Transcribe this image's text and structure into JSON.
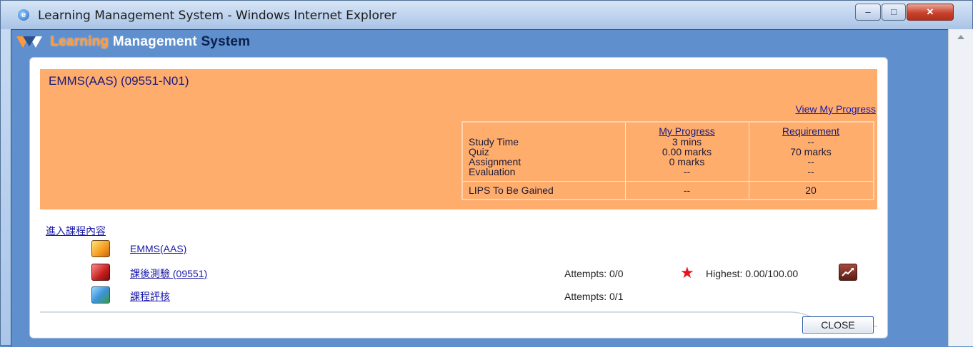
{
  "window": {
    "title": "Learning Management System - Windows Internet Explorer",
    "minimize_label": "–",
    "maximize_label": "□",
    "close_label": "✕"
  },
  "app": {
    "name_part1": "Learning",
    "name_part2": "Management",
    "name_part3": "System"
  },
  "course": {
    "title": "EMMS(AAS) (09551-N01)",
    "view_progress_label": "View My Progress"
  },
  "progress_table": {
    "headers": {
      "my_progress": "My Progress",
      "requirement": "Requirement"
    },
    "rows": [
      {
        "label": "Study Time",
        "progress": "3 mins",
        "requirement": "--"
      },
      {
        "label": "Quiz",
        "progress": "0.00 marks",
        "requirement": "70 marks"
      },
      {
        "label": "Assignment",
        "progress": "0 marks",
        "requirement": "--"
      },
      {
        "label": "Evaluation",
        "progress": "--",
        "requirement": "--"
      }
    ],
    "lips": {
      "label": "LIPS To Be Gained",
      "progress": "--",
      "requirement": "20"
    }
  },
  "content": {
    "enter_label": "進入課程內容",
    "items": [
      {
        "icon": "courseware-icon",
        "label": "EMMS(AAS)",
        "attempts": ""
      },
      {
        "icon": "quiz-icon",
        "label": "課後測驗 (09551)",
        "attempts": "Attempts: 0/0"
      },
      {
        "icon": "evaluation-icon",
        "label": "課程評核",
        "attempts": "Attempts: 0/1"
      }
    ],
    "highest": "Highest: 0.00/100.00"
  },
  "actions": {
    "close_label": "CLOSE"
  },
  "colors": {
    "panel_orange": "#ffad6c",
    "link_blue": "#1a1aa8",
    "star_red": "#e8141b"
  }
}
